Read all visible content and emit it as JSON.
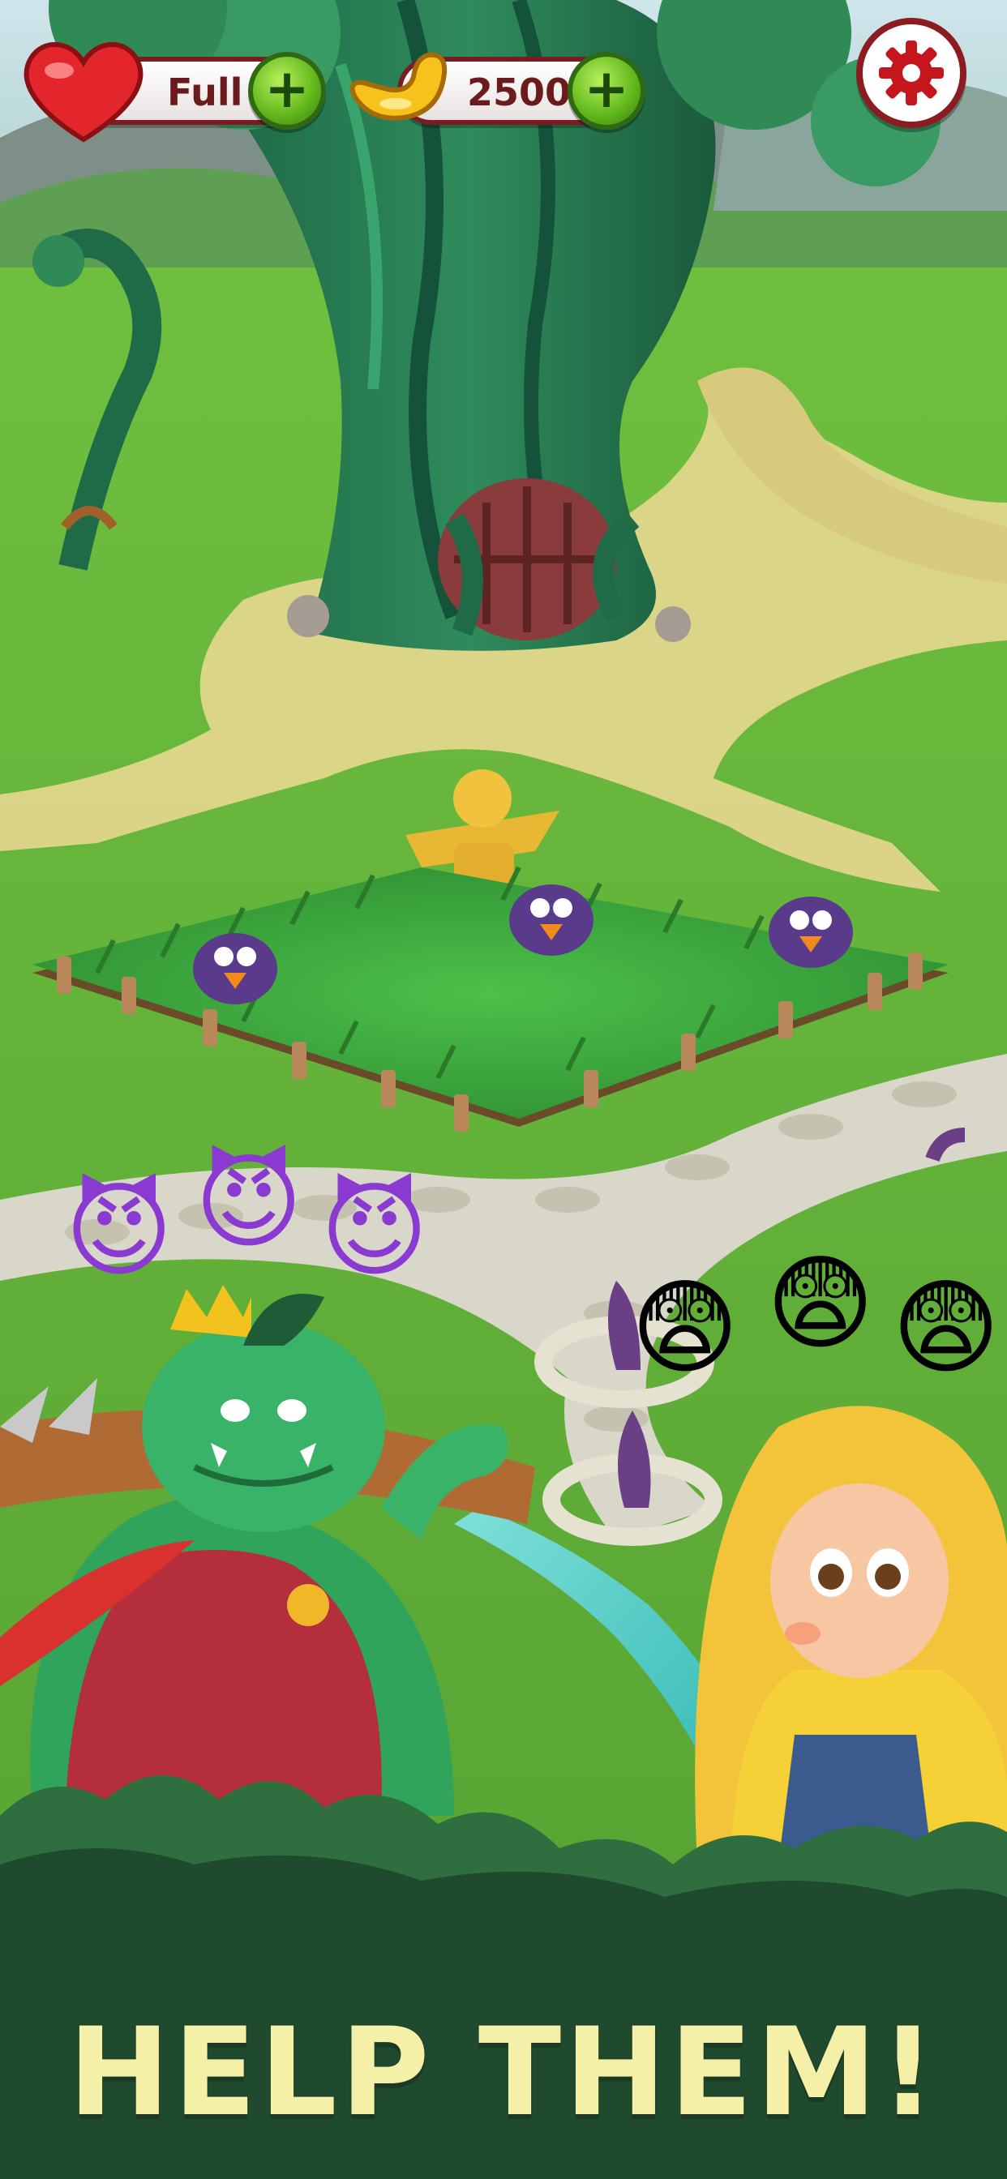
{
  "hud": {
    "lives": {
      "value": "Full",
      "icon": "heart-icon"
    },
    "currency": {
      "value": "2500",
      "icon": "jellybean-icon"
    },
    "add_icon": "plus-icon",
    "settings_icon": "gear-icon"
  },
  "banner": {
    "text": "HELP THEM!"
  },
  "emojis": {
    "villains": [
      "😈",
      "😈",
      "😈"
    ],
    "scared": [
      "😨",
      "😨",
      "😨"
    ]
  },
  "colors": {
    "frame": "#7a1d22",
    "plus": "#5fb51b",
    "banner_text": "#f4f0a8",
    "footer": "#1f4a2e"
  }
}
